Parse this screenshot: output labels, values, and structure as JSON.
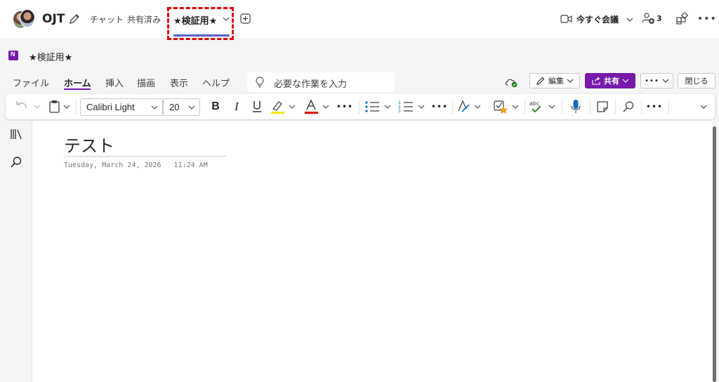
{
  "header": {
    "team_name": "OJT",
    "tabs": [
      {
        "label": "チャット"
      },
      {
        "label": "共有済み"
      }
    ],
    "active_tab": {
      "label": "★検証用★"
    },
    "meet_now": "今すぐ会議",
    "participant_count": "3"
  },
  "onenote": {
    "notebook_title": "★検証用★",
    "menu": [
      "ファイル",
      "ホーム",
      "挿入",
      "描画",
      "表示",
      "ヘルプ"
    ],
    "tell_me_placeholder": "必要な作業を入力",
    "edit_label": "編集",
    "share_label": "共有",
    "close_label": "閉じる",
    "ribbon": {
      "font_name": "Calibri Light",
      "font_size": "20"
    }
  },
  "page": {
    "title": "テスト",
    "date": "Tuesday, March 24, 2026",
    "time": "11:24 AM"
  },
  "colors": {
    "brand_purple": "#7719aa",
    "teams_accent": "#5b5fc7",
    "highlight_box": "#e00000"
  }
}
